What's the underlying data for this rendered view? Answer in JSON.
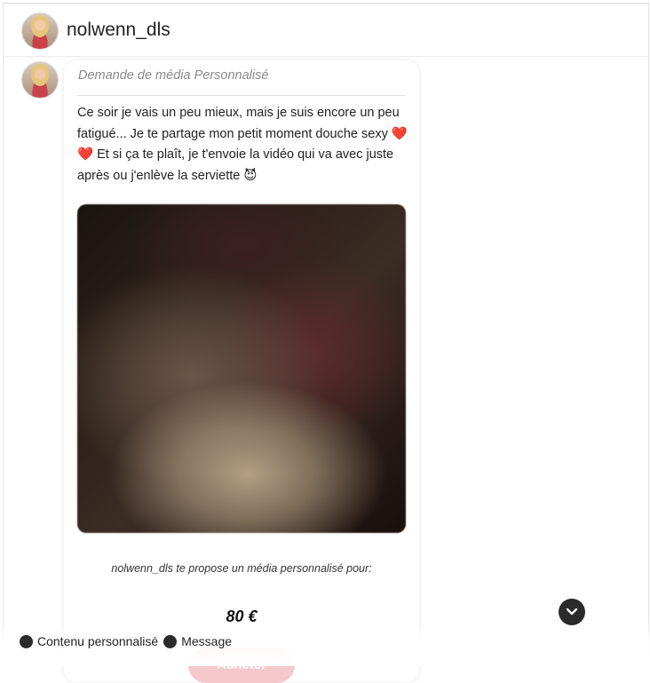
{
  "header": {
    "username": "nolwenn_dls",
    "avatar_icon": "profile-photo"
  },
  "message": {
    "title": "Demande de média Personnalisé",
    "text": "Ce soir je vais un peu mieux, mais je suis encore un peu fatigué...  Je te partage mon petit moment douche sexy ❤️❤️   Et si ça te plaît, je t'envoie la vidéo qui va avec juste après ou j'enlève la serviette 😈",
    "media_label": "blurred-media",
    "proposal_text": "nolwenn_dls te propose un média personnalisé pour:",
    "price": "80 €",
    "buy_label": "Acheter"
  },
  "legend": {
    "items": [
      {
        "label": "Contenu personnalisé"
      },
      {
        "label": "Message"
      }
    ]
  },
  "colors": {
    "accent": "#f5c8cc",
    "dark": "#2b2b2b"
  }
}
